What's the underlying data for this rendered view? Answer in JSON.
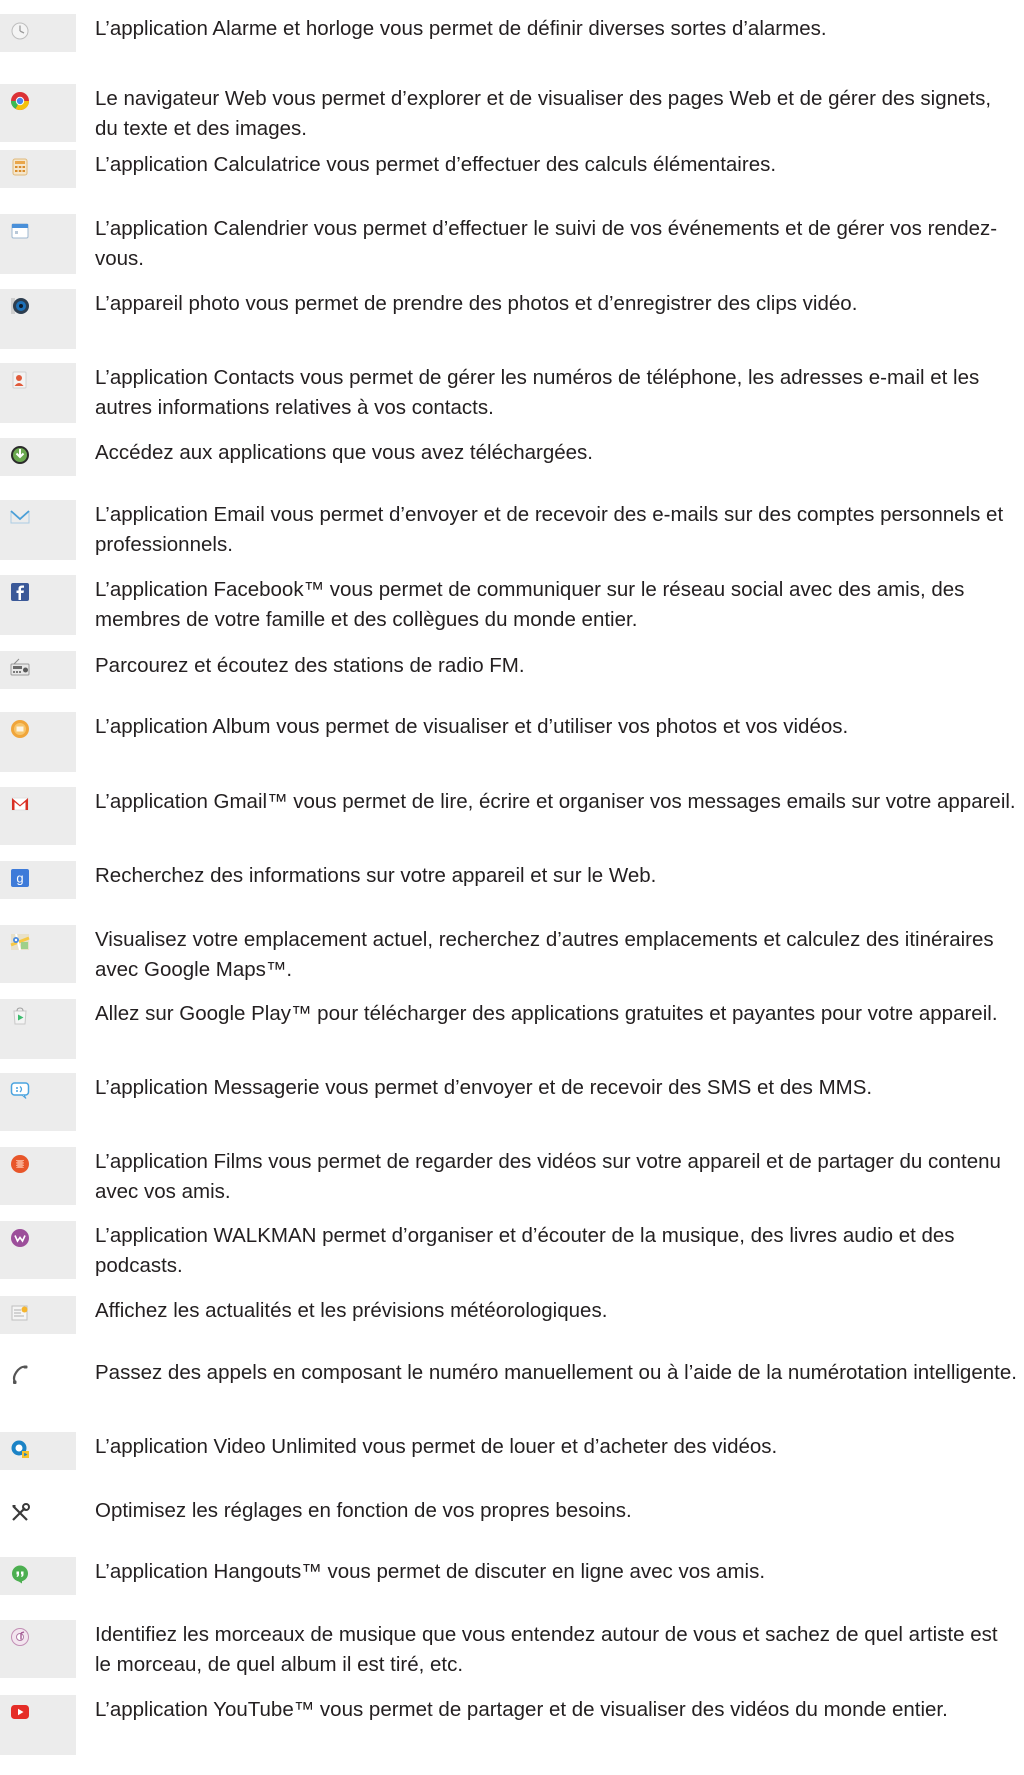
{
  "items": [
    {
      "icon": "clock-icon",
      "text": "L’application Alarme et horloge vous permet de définir diverses sortes d’alarmes."
    },
    {
      "icon": "browser-icon",
      "text": "Le navigateur Web vous permet d’explorer et de visualiser des pages Web et de gérer des signets, du texte et des images."
    },
    {
      "icon": "calculator-icon",
      "text": "L’application Calculatrice vous permet d’effectuer des calculs élémentaires."
    },
    {
      "icon": "calendar-icon",
      "text": "L’application Calendrier vous permet d’effectuer le suivi de vos événements et de gérer vos rendez-vous."
    },
    {
      "icon": "camera-icon",
      "text": "L’appareil photo vous permet de prendre des photos et d’enregistrer des clips vidéo."
    },
    {
      "icon": "contacts-icon",
      "text": "L’application Contacts vous permet de gérer les numéros de téléphone, les adresses e-mail et les autres informations relatives à vos contacts."
    },
    {
      "icon": "downloads-icon",
      "text": "Accédez aux applications que vous avez téléchargées."
    },
    {
      "icon": "email-icon",
      "text": "L’application Email vous permet d’envoyer et de recevoir des e-mails sur des comptes personnels et professionnels."
    },
    {
      "icon": "facebook-icon",
      "text": "L’application Facebook™ vous permet de communiquer sur le réseau social avec des amis, des membres de votre famille et des collègues du monde entier."
    },
    {
      "icon": "fm-radio-icon",
      "text": "Parcourez et écoutez des stations de radio FM."
    },
    {
      "icon": "album-icon",
      "text": "L’application Album vous permet de visualiser et d’utiliser vos photos et vos vidéos."
    },
    {
      "icon": "gmail-icon",
      "text": "L’application Gmail™ vous permet de lire, écrire et organiser vos messages emails sur votre appareil."
    },
    {
      "icon": "google-search-icon",
      "text": "Recherchez des informations sur votre appareil et sur le Web."
    },
    {
      "icon": "maps-icon",
      "text": "Visualisez votre emplacement actuel, recherchez d’autres emplacements et calculez des itinéraires avec Google Maps™."
    },
    {
      "icon": "play-store-icon",
      "text": "Allez sur Google Play™ pour télécharger des applications gratuites et payantes pour votre appareil."
    },
    {
      "icon": "messaging-icon",
      "text": "L’application Messagerie vous permet d’envoyer et de recevoir des SMS et des MMS."
    },
    {
      "icon": "movies-icon",
      "text": "L’application Films vous permet de regarder des vidéos sur votre appareil et de partager du contenu avec vos amis."
    },
    {
      "icon": "walkman-icon",
      "text": "L’application WALKMAN permet d’organiser et d’écouter de la musique, des livres audio et des podcasts."
    },
    {
      "icon": "news-weather-icon",
      "text": "Affichez les actualités et les prévisions météorologiques."
    },
    {
      "icon": "phone-icon",
      "text": "Passez des appels en composant le numéro manuellement ou à l’aide de la numérotation intelligente."
    },
    {
      "icon": "video-unlimited-icon",
      "text": "L’application Video Unlimited vous permet de louer et d’acheter des vidéos."
    },
    {
      "icon": "settings-tools-icon",
      "text": "Optimisez les réglages en fonction de vos propres besoins."
    },
    {
      "icon": "hangouts-icon",
      "text": "L’application Hangouts™ vous permet de discuter en ligne avec vos amis."
    },
    {
      "icon": "trackid-icon",
      "text": "Identifiez les morceaux de musique que vous entendez autour de vous et sachez de quel artiste est le morceau, de quel album il est tiré, etc."
    },
    {
      "icon": "youtube-icon",
      "text": "L’application YouTube™ vous permet de partager et de visualiser des vidéos du monde entier."
    }
  ]
}
